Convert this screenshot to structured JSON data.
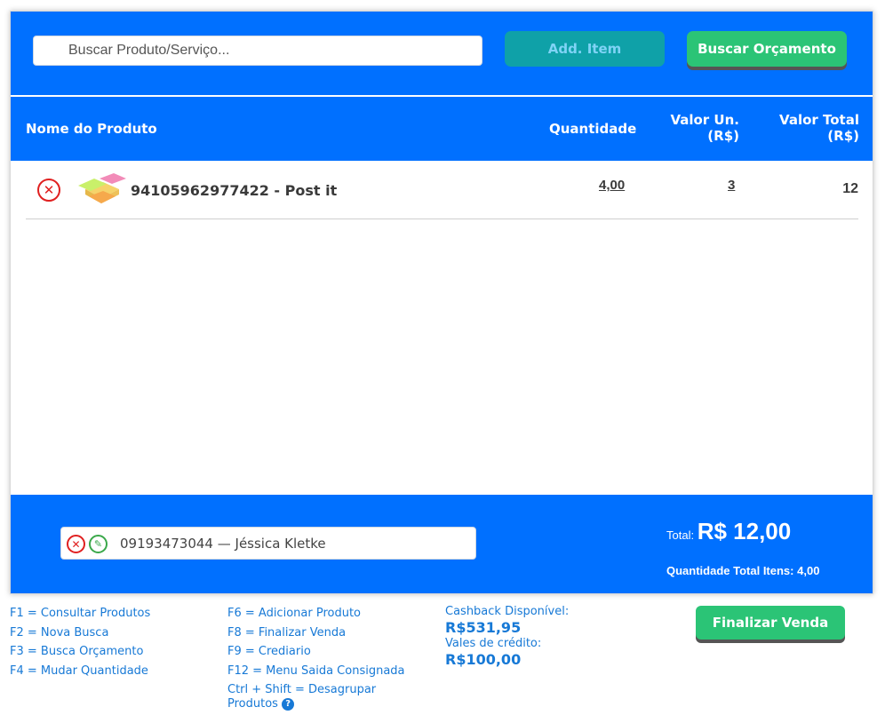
{
  "search": {
    "placeholder": "Buscar Produto/Serviço..."
  },
  "buttons": {
    "add_item": "Add. Item",
    "buscar_orcamento": "Buscar Orçamento",
    "finalizar_venda": "Finalizar Venda"
  },
  "table": {
    "headers": {
      "name": "Nome do Produto",
      "quantity": "Quantidade",
      "unit_value_line1": "Valor Un.",
      "unit_value_line2": "(R$)",
      "total_value_line1": "Valor Total",
      "total_value_line2": "(R$)"
    },
    "rows": [
      {
        "name": "94105962977422 - Post it",
        "quantity": "4,00",
        "unit_value": "3",
        "total": "12"
      }
    ]
  },
  "client": {
    "text": "09193473044 — Jéssica Kletke"
  },
  "totals": {
    "total_label": "Total:",
    "total_value": "R$ 12,00",
    "qty_label": "Quantidade Total Itens:",
    "qty_value": "4,00"
  },
  "shortcuts": {
    "col1": [
      "F1 = Consultar Produtos",
      "F2 = Nova Busca",
      "F3 = Busca Orçamento",
      "F4 = Mudar Quantidade"
    ],
    "col2": [
      "F6 = Adicionar Produto",
      "F8 = Finalizar Venda",
      "F9 = Crediario",
      "F12 = Menu Saida Consignada"
    ],
    "col2_multi_line1": "Ctrl + Shift = Desagrupar",
    "col2_multi_line2": "Produtos",
    "help_icon_glyph": "?"
  },
  "credit": {
    "cashback_label": "Cashback Disponível:",
    "cashback_value": "R$531,95",
    "vales_label": "Vales de crédito:",
    "vales_value": "R$100,00"
  },
  "icons": {
    "delete": "close-circle-icon",
    "edit": "pencil-icon",
    "help": "question-circle-icon"
  },
  "colors": {
    "primary": "#0070ff",
    "green": "#2bc476",
    "teal": "#0fa1a8",
    "danger": "#e02020",
    "link": "#1779d6"
  }
}
